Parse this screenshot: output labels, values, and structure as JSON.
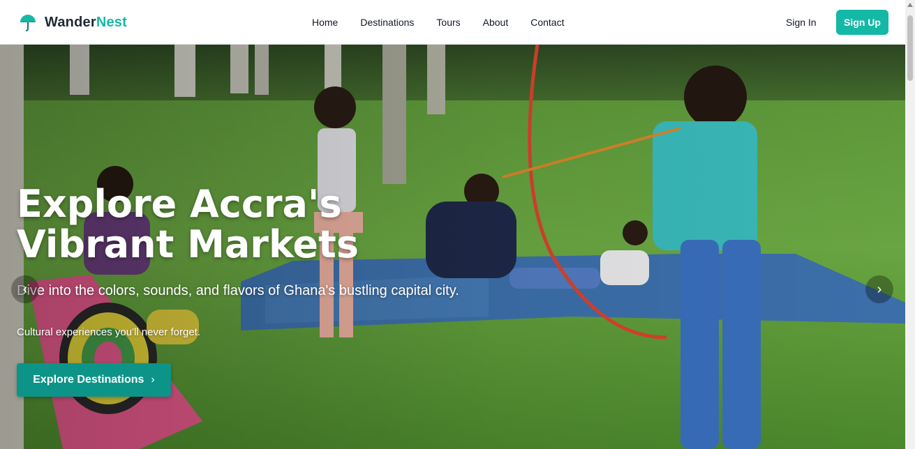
{
  "brand": {
    "name_part1": "Wander",
    "name_part2": "Nest",
    "accent_color": "#14b8a6",
    "logo_icon": "umbrella-icon"
  },
  "nav": {
    "items": [
      {
        "label": "Home"
      },
      {
        "label": "Destinations"
      },
      {
        "label": "Tours"
      },
      {
        "label": "About"
      },
      {
        "label": "Contact"
      }
    ]
  },
  "auth": {
    "sign_in_label": "Sign In",
    "sign_up_label": "Sign Up"
  },
  "hero": {
    "title": "Explore Accra's Vibrant Markets",
    "subtitle": "Dive into the colors, sounds, and flavors of Ghana's bustling capital city.",
    "tagline": "Cultural experiences you'll never forget.",
    "cta_label": "Explore Destinations",
    "cta_icon": "chevron-right-icon",
    "prev_icon": "chevron-left-icon",
    "next_icon": "chevron-right-icon",
    "cta_color": "#0d9488"
  }
}
